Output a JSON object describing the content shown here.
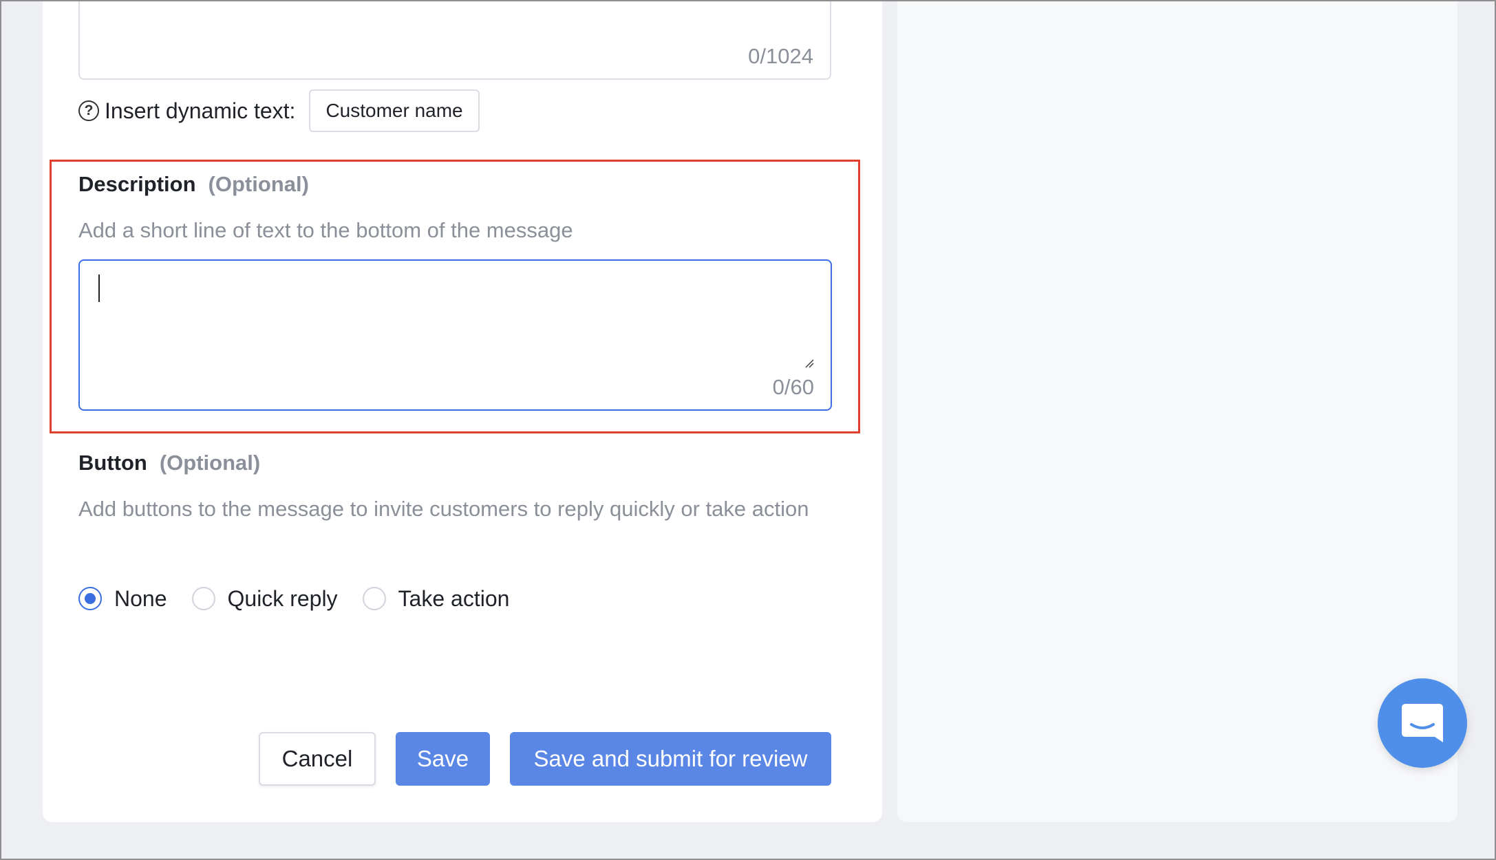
{
  "top_field": {
    "counter": "0/1024"
  },
  "dynamic_text": {
    "help_icon": "question-circle-icon",
    "label": "Insert dynamic text:",
    "chip_label": "Customer name"
  },
  "description": {
    "title": "Description",
    "optional": "(Optional)",
    "hint": "Add a short line of text to the bottom of the message",
    "value": "",
    "counter": "0/60"
  },
  "button_section": {
    "title": "Button",
    "optional": "(Optional)",
    "hint": "Add buttons to the message to invite customers to reply quickly or take action",
    "options": [
      {
        "label": "None",
        "checked": true
      },
      {
        "label": "Quick reply",
        "checked": false
      },
      {
        "label": "Take action",
        "checked": false
      }
    ]
  },
  "actions": {
    "cancel": "Cancel",
    "save": "Save",
    "submit": "Save and submit for review"
  },
  "chat_launcher": {
    "icon": "chat-bubble-icon"
  },
  "colors": {
    "accent": "#3b6de0",
    "primary_button": "#5a86e6",
    "highlight_border": "#e0402b",
    "muted_text": "#8a8f99"
  }
}
